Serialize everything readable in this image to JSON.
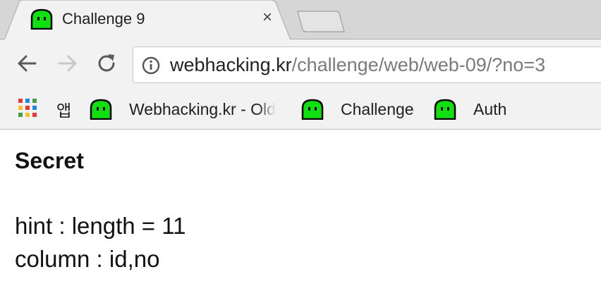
{
  "tab": {
    "title": "Challenge 9",
    "close_label": "×"
  },
  "toolbar": {
    "url_host": "webhacking.kr",
    "url_path": "/challenge/web/web-09/?no=3"
  },
  "bookmarks": {
    "items": [
      {
        "label": "앱"
      },
      {
        "label": "Webhacking.kr - Old"
      },
      {
        "label": "Challenge"
      },
      {
        "label": "Auth"
      }
    ]
  },
  "page": {
    "heading": "Secret",
    "hint": "hint : length = 11",
    "column": "column : id,no"
  },
  "colors": {
    "favicon_green": "#10e010",
    "tab_active": "#f2f2f2",
    "tab_strip": "#d6d6d6"
  }
}
